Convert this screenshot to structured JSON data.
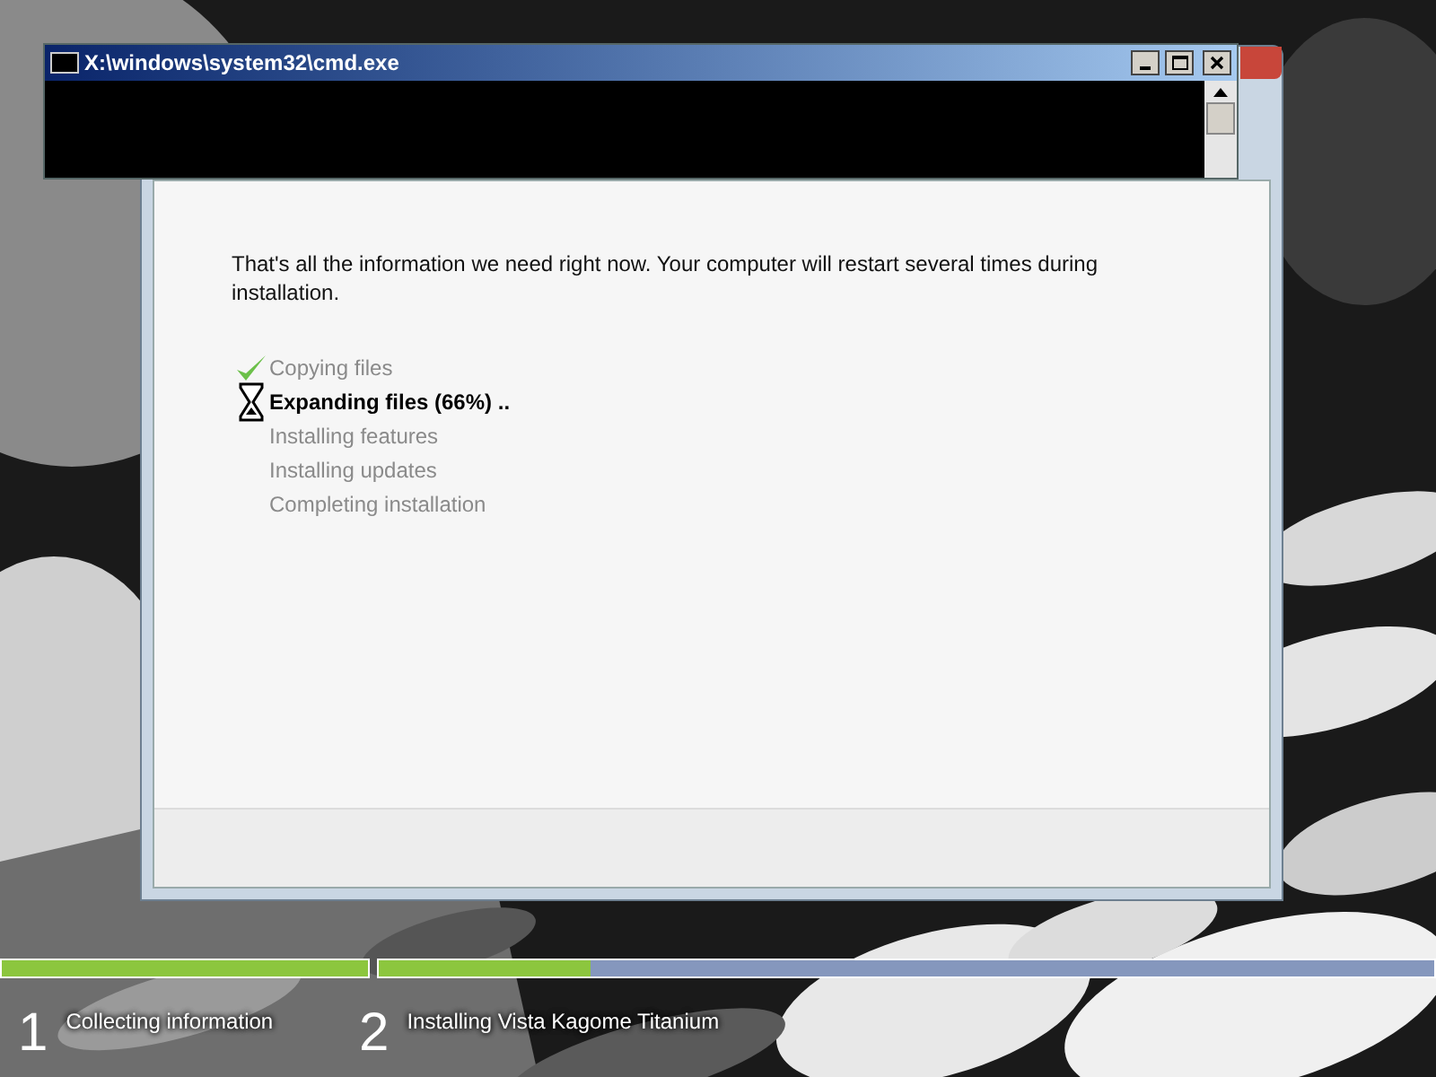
{
  "console_window": {
    "title": "X:\\windows\\system32\\cmd.exe"
  },
  "setup_window": {
    "message": "That's all the information we need right now. Your computer will restart several times during installation.",
    "steps": [
      {
        "label": "Copying files",
        "completed": true,
        "current": false
      },
      {
        "label": "Expanding files (66%) ..",
        "completed": false,
        "current": true
      },
      {
        "label": "Installing features",
        "completed": false,
        "current": false
      },
      {
        "label": "Installing updates",
        "completed": false,
        "current": false
      },
      {
        "label": "Completing installation",
        "completed": false,
        "current": false
      }
    ]
  },
  "stages": [
    {
      "number": "1",
      "label": "Collecting information",
      "level": 1
    },
    {
      "number": "2",
      "label": "Installing Vista Kagome Titanium",
      "level": 0.2
    }
  ]
}
